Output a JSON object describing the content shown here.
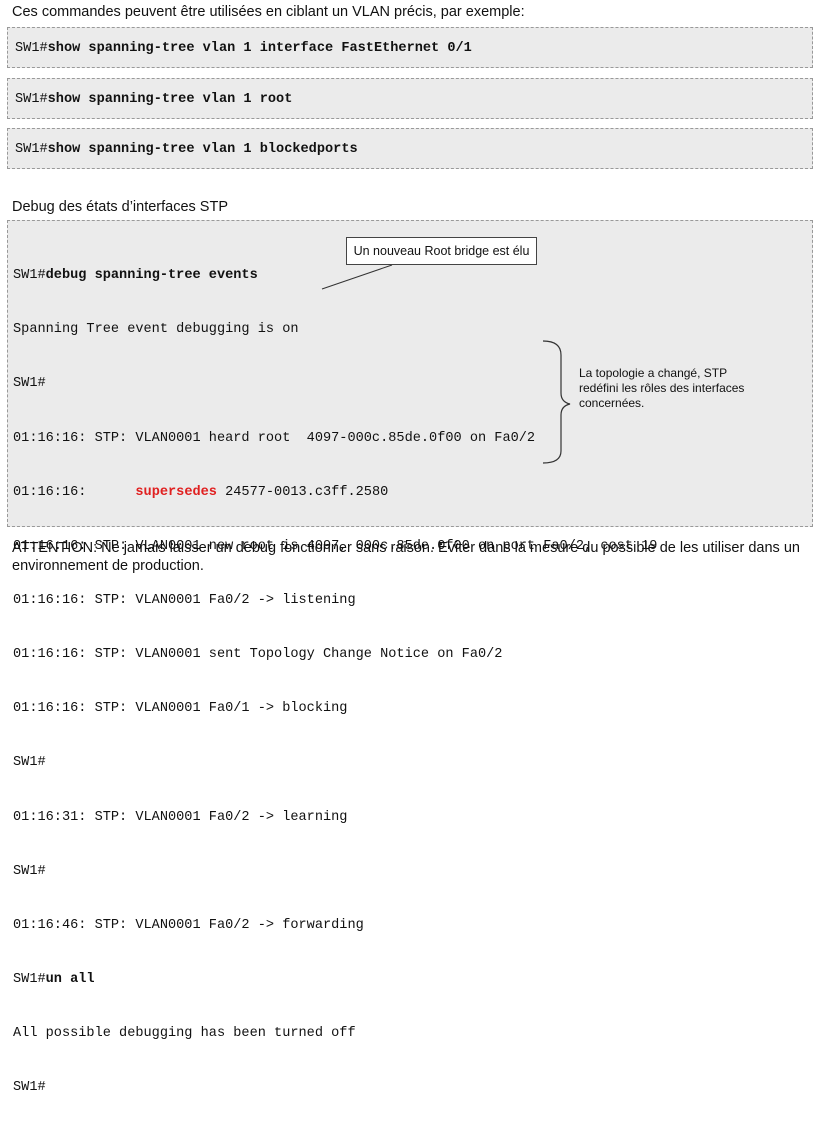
{
  "intro": "Ces commandes peuvent être utilisées en ciblant un VLAN précis, par exemple:",
  "commands": [
    {
      "prompt": "SW1#",
      "cmd": "show spanning-tree vlan 1 interface FastEthernet 0/1"
    },
    {
      "prompt": "SW1#",
      "cmd": "show spanning-tree vlan 1 root"
    },
    {
      "prompt": "SW1#",
      "cmd": "show spanning-tree vlan 1 blockedports"
    }
  ],
  "debug_title": "Debug des états d’interfaces STP",
  "debug": {
    "l0_prompt": "SW1#",
    "l0_cmd": "debug spanning-tree events",
    "l1": "Spanning Tree event debugging is on",
    "l2": "SW1#",
    "l3": "01:16:16: STP: VLAN0001 heard root  4097-000c.85de.0f00 on Fa0/2",
    "l4_pre": "01:16:16:      ",
    "l4_red": "supersedes",
    "l4_post": " 24577-0013.c3ff.2580",
    "l5": "01:16:16: STP: VLAN0001 new root is 4097, 000c.85de.0f00 on port Fa0/2, cost 19",
    "l6": "01:16:16: STP: VLAN0001 Fa0/2 -> listening",
    "l7": "01:16:16: STP: VLAN0001 sent Topology Change Notice on Fa0/2",
    "l8": "01:16:16: STP: VLAN0001 Fa0/1 -> blocking",
    "l9": "SW1#",
    "l10": "01:16:31: STP: VLAN0001 Fa0/2 -> learning",
    "l11": "SW1#",
    "l12": "01:16:46: STP: VLAN0001 Fa0/2 -> forwarding",
    "l13_prompt": "SW1#",
    "l13_cmd": "un all",
    "l14": "All possible debugging has been turned off",
    "l15": "SW1#"
  },
  "callout": "Un nouveau Root bridge est élu",
  "note": "La topologie a changé, STP redéfini les rôles des interfaces concernées.",
  "warning": "ATTENTION: Ne jamais laisser un debug fonctionner sans raison. Eviter dans la mesure du possible de les utiliser dans un environnement de production."
}
